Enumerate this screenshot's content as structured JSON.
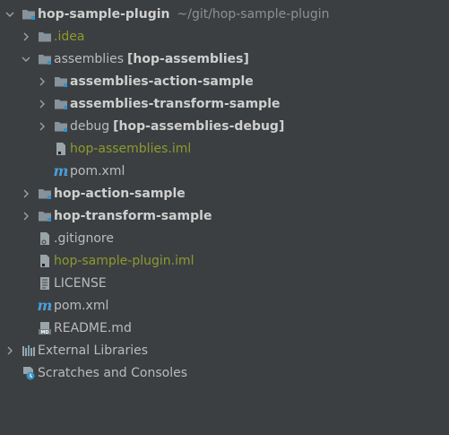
{
  "tree": {
    "root": {
      "name": "hop-sample-plugin",
      "path": "~/git/hop-sample-plugin"
    },
    "idea": "idea",
    "assemblies": {
      "name": "assemblies",
      "module": "[hop-assemblies]"
    },
    "assemblies_action": "assemblies-action-sample",
    "assemblies_transform": "assemblies-transform-sample",
    "debug": {
      "name": "debug",
      "module": "[hop-assemblies-debug]"
    },
    "assemblies_iml": "hop-assemblies.iml",
    "assemblies_pom": "pom.xml",
    "action_sample": "hop-action-sample",
    "transform_sample": "hop-transform-sample",
    "gitignore": ".gitignore",
    "plugin_iml": "hop-sample-plugin.iml",
    "license": "LICENSE",
    "pom": "pom.xml",
    "readme": "README.md",
    "external_libraries": "External Libraries",
    "scratches": "Scratches and Consoles"
  },
  "colors": {
    "background": "#3c3f41",
    "text": "#bbbbbb",
    "excluded": "#8c9a2e",
    "maven": "#4a9fd8"
  },
  "icons": {
    "folder": "folder-icon",
    "module": "module-folder-icon",
    "file": "file-icon",
    "maven": "maven-m-icon",
    "libraries": "library-icon",
    "scratches": "scratches-icon"
  }
}
